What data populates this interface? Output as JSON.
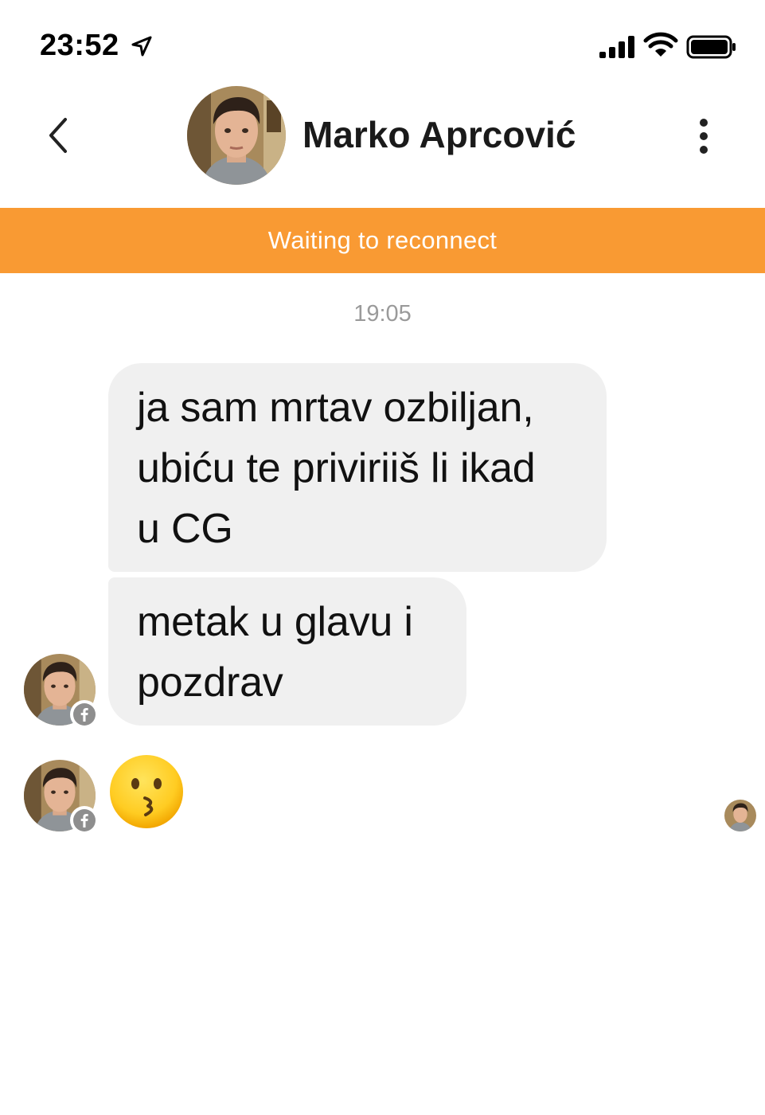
{
  "status_bar": {
    "time": "23:52",
    "icons": [
      "location-arrow-icon",
      "cellular-signal-icon",
      "wifi-icon",
      "battery-icon"
    ]
  },
  "header": {
    "contact_name": "Marko Aprcović",
    "back_icon": "chevron-left-icon",
    "more_icon": "vertical-dots-icon"
  },
  "banner": {
    "text": "Waiting to reconnect",
    "color": "#f99a33"
  },
  "conversation": {
    "timestamp": "19:05",
    "messages": [
      {
        "from": "contact",
        "type": "text",
        "lines": [
          "ja sam mrtav ozbiljan,",
          "ubiću te priviriiš li ikad",
          "u CG"
        ]
      },
      {
        "from": "contact",
        "type": "text",
        "lines": [
          "metak u glavu i",
          "pozdrav"
        ]
      },
      {
        "from": "contact",
        "type": "emoji",
        "emoji_name": "kissing-face-emoji"
      }
    ],
    "avatar_badge_icon": "facebook-icon",
    "bubble_color": "#f0f0f0"
  }
}
